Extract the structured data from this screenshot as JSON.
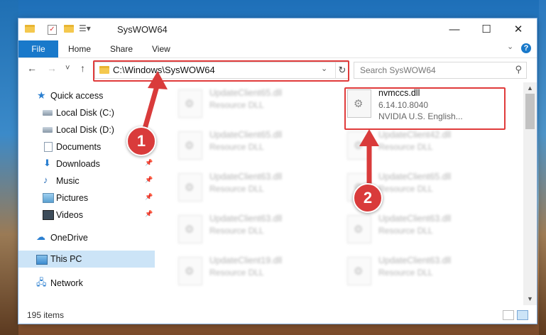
{
  "window": {
    "title": "SysWOW64",
    "minimize": "—",
    "maximize": "☐",
    "close": "✕"
  },
  "ribbon": {
    "file": "File",
    "tabs": [
      "Home",
      "Share",
      "View"
    ]
  },
  "nav": {
    "back": "←",
    "forward": "→",
    "recent": "˅",
    "up": "↑",
    "address": "C:\\Windows\\SysWOW64",
    "search_placeholder": "Search SysWOW64"
  },
  "sidebar": {
    "items": [
      {
        "label": "Quick access",
        "icon": "star-icon"
      },
      {
        "label": "Local Disk (C:)",
        "icon": "drive-icon"
      },
      {
        "label": "Local Disk (D:)",
        "icon": "drive-icon"
      },
      {
        "label": "Documents",
        "icon": "documents-icon"
      },
      {
        "label": "Downloads",
        "icon": "download-icon"
      },
      {
        "label": "Music",
        "icon": "music-icon"
      },
      {
        "label": "Pictures",
        "icon": "pictures-icon"
      },
      {
        "label": "Videos",
        "icon": "videos-icon"
      },
      {
        "label": "OneDrive",
        "icon": "cloud-icon"
      },
      {
        "label": "This PC",
        "icon": "computer-icon"
      },
      {
        "label": "Network",
        "icon": "network-icon"
      }
    ]
  },
  "files": {
    "highlighted": {
      "name": "nvmccs.dll",
      "version": "6.14.10.8040",
      "company": "NVIDIA U.S. English..."
    },
    "left_column": [
      {
        "name": "UpdateClient65.dll",
        "type": "Resource DLL"
      },
      {
        "name": "UpdateClient65.dll",
        "type": "Resource DLL"
      },
      {
        "name": "UpdateClient63.dll",
        "type": "Resource DLL"
      },
      {
        "name": "UpdateClient63.dll",
        "type": "Resource DLL"
      },
      {
        "name": "UpdateClient19.dll",
        "type": "Resource DLL"
      }
    ],
    "right_column": [
      {
        "name": "UpdateClient42.dll",
        "type": "Resource DLL"
      },
      {
        "name": "UpdateClient65.dll",
        "type": "Resource DLL"
      },
      {
        "name": "UpdateClient63.dll",
        "type": "Resource DLL"
      },
      {
        "name": "UpdateClient63.dll",
        "type": "Resource DLL"
      }
    ]
  },
  "status": {
    "items": "195 items"
  },
  "callouts": {
    "one": "1",
    "two": "2"
  },
  "colors": {
    "accent": "#1979ca",
    "highlight": "#e03b3b",
    "selected": "#cce4f7"
  }
}
